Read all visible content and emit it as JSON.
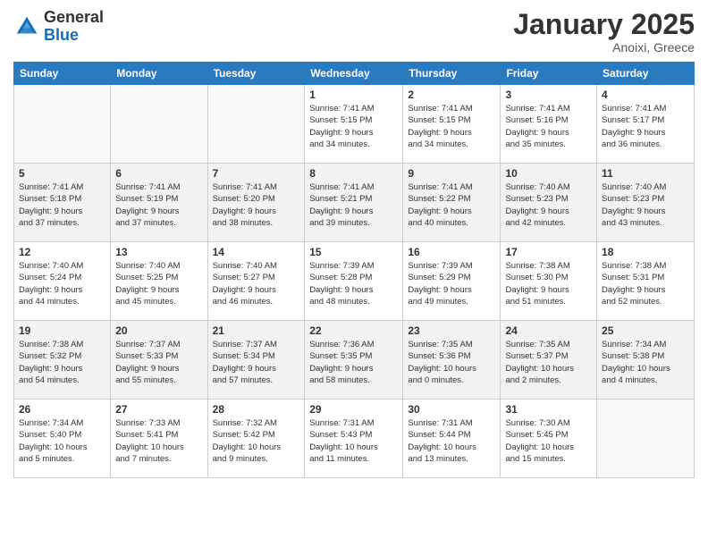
{
  "logo": {
    "general": "General",
    "blue": "Blue"
  },
  "title": "January 2025",
  "location": "Anoixi, Greece",
  "days_header": [
    "Sunday",
    "Monday",
    "Tuesday",
    "Wednesday",
    "Thursday",
    "Friday",
    "Saturday"
  ],
  "weeks": [
    [
      {
        "num": "",
        "info": ""
      },
      {
        "num": "",
        "info": ""
      },
      {
        "num": "",
        "info": ""
      },
      {
        "num": "1",
        "info": "Sunrise: 7:41 AM\nSunset: 5:15 PM\nDaylight: 9 hours\nand 34 minutes."
      },
      {
        "num": "2",
        "info": "Sunrise: 7:41 AM\nSunset: 5:15 PM\nDaylight: 9 hours\nand 34 minutes."
      },
      {
        "num": "3",
        "info": "Sunrise: 7:41 AM\nSunset: 5:16 PM\nDaylight: 9 hours\nand 35 minutes."
      },
      {
        "num": "4",
        "info": "Sunrise: 7:41 AM\nSunset: 5:17 PM\nDaylight: 9 hours\nand 36 minutes."
      }
    ],
    [
      {
        "num": "5",
        "info": "Sunrise: 7:41 AM\nSunset: 5:18 PM\nDaylight: 9 hours\nand 37 minutes."
      },
      {
        "num": "6",
        "info": "Sunrise: 7:41 AM\nSunset: 5:19 PM\nDaylight: 9 hours\nand 37 minutes."
      },
      {
        "num": "7",
        "info": "Sunrise: 7:41 AM\nSunset: 5:20 PM\nDaylight: 9 hours\nand 38 minutes."
      },
      {
        "num": "8",
        "info": "Sunrise: 7:41 AM\nSunset: 5:21 PM\nDaylight: 9 hours\nand 39 minutes."
      },
      {
        "num": "9",
        "info": "Sunrise: 7:41 AM\nSunset: 5:22 PM\nDaylight: 9 hours\nand 40 minutes."
      },
      {
        "num": "10",
        "info": "Sunrise: 7:40 AM\nSunset: 5:23 PM\nDaylight: 9 hours\nand 42 minutes."
      },
      {
        "num": "11",
        "info": "Sunrise: 7:40 AM\nSunset: 5:23 PM\nDaylight: 9 hours\nand 43 minutes."
      }
    ],
    [
      {
        "num": "12",
        "info": "Sunrise: 7:40 AM\nSunset: 5:24 PM\nDaylight: 9 hours\nand 44 minutes."
      },
      {
        "num": "13",
        "info": "Sunrise: 7:40 AM\nSunset: 5:25 PM\nDaylight: 9 hours\nand 45 minutes."
      },
      {
        "num": "14",
        "info": "Sunrise: 7:40 AM\nSunset: 5:27 PM\nDaylight: 9 hours\nand 46 minutes."
      },
      {
        "num": "15",
        "info": "Sunrise: 7:39 AM\nSunset: 5:28 PM\nDaylight: 9 hours\nand 48 minutes."
      },
      {
        "num": "16",
        "info": "Sunrise: 7:39 AM\nSunset: 5:29 PM\nDaylight: 9 hours\nand 49 minutes."
      },
      {
        "num": "17",
        "info": "Sunrise: 7:38 AM\nSunset: 5:30 PM\nDaylight: 9 hours\nand 51 minutes."
      },
      {
        "num": "18",
        "info": "Sunrise: 7:38 AM\nSunset: 5:31 PM\nDaylight: 9 hours\nand 52 minutes."
      }
    ],
    [
      {
        "num": "19",
        "info": "Sunrise: 7:38 AM\nSunset: 5:32 PM\nDaylight: 9 hours\nand 54 minutes."
      },
      {
        "num": "20",
        "info": "Sunrise: 7:37 AM\nSunset: 5:33 PM\nDaylight: 9 hours\nand 55 minutes."
      },
      {
        "num": "21",
        "info": "Sunrise: 7:37 AM\nSunset: 5:34 PM\nDaylight: 9 hours\nand 57 minutes."
      },
      {
        "num": "22",
        "info": "Sunrise: 7:36 AM\nSunset: 5:35 PM\nDaylight: 9 hours\nand 58 minutes."
      },
      {
        "num": "23",
        "info": "Sunrise: 7:35 AM\nSunset: 5:36 PM\nDaylight: 10 hours\nand 0 minutes."
      },
      {
        "num": "24",
        "info": "Sunrise: 7:35 AM\nSunset: 5:37 PM\nDaylight: 10 hours\nand 2 minutes."
      },
      {
        "num": "25",
        "info": "Sunrise: 7:34 AM\nSunset: 5:38 PM\nDaylight: 10 hours\nand 4 minutes."
      }
    ],
    [
      {
        "num": "26",
        "info": "Sunrise: 7:34 AM\nSunset: 5:40 PM\nDaylight: 10 hours\nand 5 minutes."
      },
      {
        "num": "27",
        "info": "Sunrise: 7:33 AM\nSunset: 5:41 PM\nDaylight: 10 hours\nand 7 minutes."
      },
      {
        "num": "28",
        "info": "Sunrise: 7:32 AM\nSunset: 5:42 PM\nDaylight: 10 hours\nand 9 minutes."
      },
      {
        "num": "29",
        "info": "Sunrise: 7:31 AM\nSunset: 5:43 PM\nDaylight: 10 hours\nand 11 minutes."
      },
      {
        "num": "30",
        "info": "Sunrise: 7:31 AM\nSunset: 5:44 PM\nDaylight: 10 hours\nand 13 minutes."
      },
      {
        "num": "31",
        "info": "Sunrise: 7:30 AM\nSunset: 5:45 PM\nDaylight: 10 hours\nand 15 minutes."
      },
      {
        "num": "",
        "info": ""
      }
    ]
  ]
}
